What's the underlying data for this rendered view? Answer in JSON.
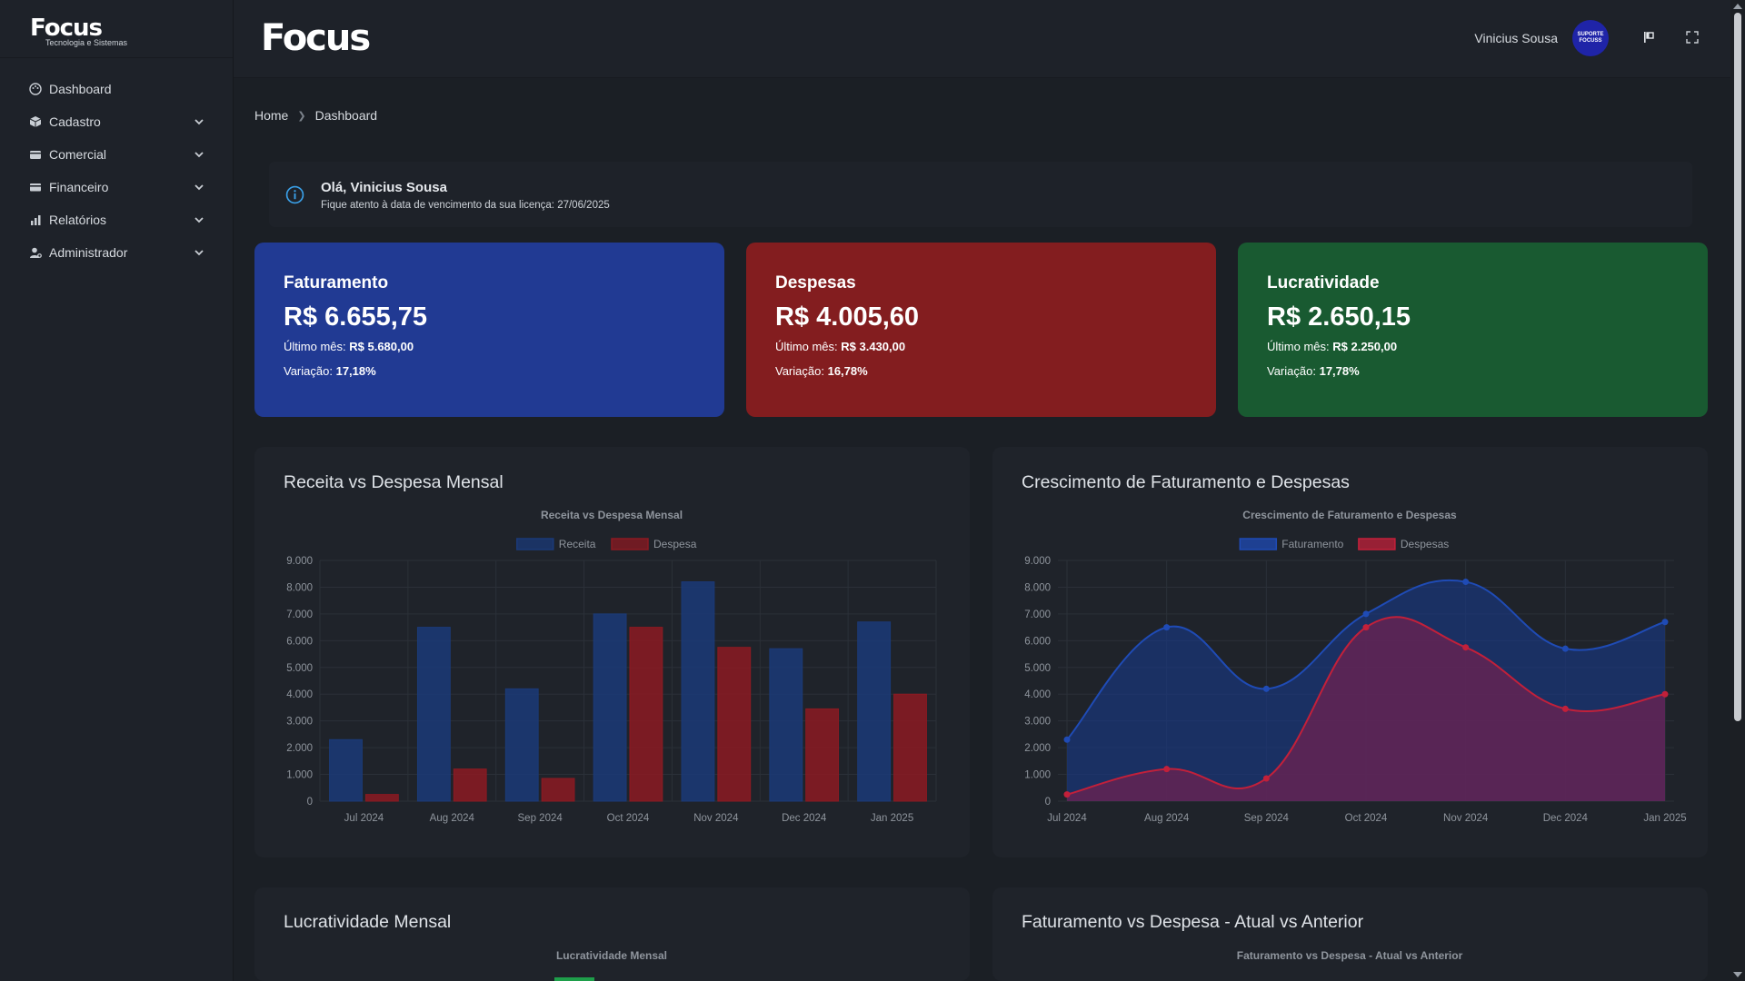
{
  "sidebar": {
    "logo": "Focus",
    "logo_sub": "Tecnologia e Sistemas",
    "items": [
      {
        "label": "Dashboard",
        "icon": "palette-icon"
      },
      {
        "label": "Cadastro",
        "icon": "cube-icon"
      },
      {
        "label": "Comercial",
        "icon": "wallet-icon"
      },
      {
        "label": "Financeiro",
        "icon": "card-icon"
      },
      {
        "label": "Relatórios",
        "icon": "bar-chart-icon"
      },
      {
        "label": "Administrador",
        "icon": "user-gear-icon"
      }
    ]
  },
  "header": {
    "logo": "Focus",
    "user_name": "Vinicius Sousa",
    "avatar_text": "SUPORTE FOCUSS"
  },
  "breadcrumb": {
    "home": "Home",
    "current": "Dashboard"
  },
  "alert": {
    "title": "Olá, Vinicius Sousa",
    "text": "Fique atento à data de vencimento da sua licença: 27/06/2025"
  },
  "cards": [
    {
      "title": "Faturamento",
      "value": "R$ 6.655,75",
      "last_label": "Último mês:",
      "last_value": "R$ 5.680,00",
      "var_label": "Variação:",
      "var_value": "17,18%",
      "color": "#213a93"
    },
    {
      "title": "Despesas",
      "value": "R$ 4.005,60",
      "last_label": "Último mês:",
      "last_value": "R$ 3.430,00",
      "var_label": "Variação:",
      "var_value": "16,78%",
      "color": "#831d1f"
    },
    {
      "title": "Lucratividade",
      "value": "R$ 2.650,15",
      "last_label": "Último mês:",
      "last_value": "R$ 2.250,00",
      "var_label": "Variação:",
      "var_value": "17,78%",
      "color": "#195a31"
    }
  ],
  "panels": [
    {
      "title": "Receita vs Despesa Mensal"
    },
    {
      "title": "Crescimento de Faturamento e Despesas"
    },
    {
      "title": "Lucratividade Mensal"
    },
    {
      "title": "Faturamento vs Despesa - Atual vs Anterior"
    }
  ],
  "chart_data": [
    {
      "type": "bar",
      "title": "Receita vs Despesa Mensal",
      "categories": [
        "Jul 2024",
        "Aug 2024",
        "Sep 2024",
        "Oct 2024",
        "Nov 2024",
        "Dec 2024",
        "Jan 2025"
      ],
      "series": [
        {
          "name": "Receita",
          "values": [
            2300,
            6500,
            4200,
            7000,
            8200,
            5700,
            6700
          ],
          "color": "#1b3a78"
        },
        {
          "name": "Despesa",
          "values": [
            250,
            1200,
            850,
            6500,
            5750,
            3450,
            4000
          ],
          "color": "#8c1a22"
        }
      ],
      "ylim": [
        0,
        9000
      ],
      "yticks": [
        "0",
        "1.000",
        "2.000",
        "3.000",
        "4.000",
        "5.000",
        "6.000",
        "7.000",
        "8.000",
        "9.000"
      ],
      "legend": "top",
      "grid": true
    },
    {
      "type": "area",
      "title": "Crescimento de Faturamento e Despesas",
      "categories": [
        "Jul 2024",
        "Aug 2024",
        "Sep 2024",
        "Oct 2024",
        "Nov 2024",
        "Dec 2024",
        "Jan 2025"
      ],
      "series": [
        {
          "name": "Faturamento",
          "values": [
            2300,
            6500,
            4200,
            7000,
            8200,
            5700,
            6700
          ],
          "color": "#1f4bb5"
        },
        {
          "name": "Despesas",
          "values": [
            250,
            1200,
            850,
            6500,
            5750,
            3450,
            4000
          ],
          "color": "#c2203a"
        }
      ],
      "ylim": [
        0,
        9000
      ],
      "yticks": [
        "0",
        "1.000",
        "2.000",
        "3.000",
        "4.000",
        "5.000",
        "6.000",
        "7.000",
        "8.000",
        "9.000"
      ],
      "legend": "top",
      "grid": true
    },
    {
      "type": "bar",
      "title": "Lucratividade Mensal"
    },
    {
      "type": "bar",
      "title": "Faturamento vs Despesa - Atual vs Anterior"
    }
  ]
}
